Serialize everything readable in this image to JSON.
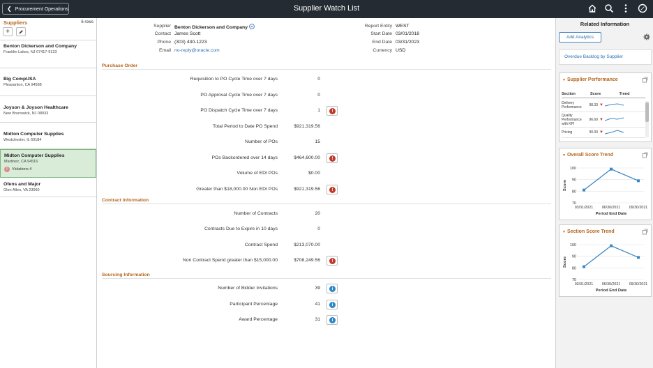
{
  "header": {
    "back_label": "Procurement Operations",
    "title": "Supplier Watch List"
  },
  "left": {
    "title": "Suppliers",
    "rows": "6 rows",
    "suppliers": [
      {
        "name": "Benton Dickerson and Company",
        "addr": "Franklin Lakes, NJ  07417-9123"
      },
      {
        "name": "Big CompUSA",
        "addr": "Pleasanton, CA  94588"
      },
      {
        "name": "Joyson & Joyson Healthcare",
        "addr": "New Brunswick, NJ  08933"
      },
      {
        "name": "Midton Computer Supplies",
        "addr": "Westchester, IL  60184"
      },
      {
        "name": "Midton Computer Supplies",
        "addr": "Martinez, CA  94516",
        "violations": "Violations 4"
      },
      {
        "name": "Ofens and Major",
        "addr": "Glen Allen, VA  23060"
      }
    ]
  },
  "info": {
    "supplier_label": "Supplier",
    "supplier": "Benton Dickerson and Company",
    "contact_label": "Contact",
    "contact": "James Scott",
    "phone_label": "Phone",
    "phone": "(303) 430-1223",
    "email_label": "Email",
    "email": "no-reply@oracle.com",
    "entity_label": "Report Entity",
    "entity": "WEST",
    "start_label": "Start Date",
    "start": "03/01/2018",
    "end_label": "End Date",
    "end": "03/31/2023",
    "currency_label": "Currency",
    "currency": "USD"
  },
  "sections": {
    "po": {
      "title": "Purchase Order",
      "rows": [
        {
          "label": "Requisition to PO Cycle Time over 7 days",
          "value": "0"
        },
        {
          "label": "PO Approval Cycle Time over 7 days",
          "value": "0"
        },
        {
          "label": "PO Dispatch Cycle Time over 7 days",
          "value": "1",
          "alert": "red"
        },
        {
          "label": "Total Period to Date PO Spend",
          "value": "$921,319.56"
        },
        {
          "label": "Number of POs",
          "value": "15"
        },
        {
          "label": "POs Backordered over 14 days",
          "value": "$464,600.00",
          "alert": "red"
        },
        {
          "label": "Volume of EDI POs",
          "value": "$0.00"
        },
        {
          "label": "Greater than $18,000.00 Non EDI POs",
          "value": "$921,319.56",
          "alert": "red"
        }
      ]
    },
    "contract": {
      "title": "Contract Information",
      "rows": [
        {
          "label": "Number of Contracts",
          "value": "20"
        },
        {
          "label": "Contracts Due to Expire in 10 days",
          "value": "0"
        },
        {
          "label": "Contract Spend",
          "value": "$213,070.00"
        },
        {
          "label": "Non Contract Spend greater than $15,000.00",
          "value": "$708,249.56",
          "alert": "red"
        }
      ]
    },
    "sourcing": {
      "title": "Sourcing Information",
      "rows": [
        {
          "label": "Number of Bidder Invitations",
          "value": "39",
          "alert": "blue"
        },
        {
          "label": "Participant Percentage",
          "value": "41",
          "alert": "blue"
        },
        {
          "label": "Award Percentage",
          "value": "31",
          "alert": "blue"
        }
      ]
    }
  },
  "right": {
    "title": "Related Information",
    "add_analytics": "Add Analytics",
    "overdue_link": "Overdue Backlog by Supplier",
    "supplier_perf": {
      "title": "Supplier Performance",
      "headers": [
        "Section",
        "Score",
        "Trend"
      ],
      "rows": [
        {
          "section": "Delivery Performance",
          "score": "98.33"
        },
        {
          "section": "Quality Performance with KPI",
          "score": "96.60"
        },
        {
          "section": "Pricing",
          "score": "90.00"
        }
      ]
    },
    "overall": {
      "title": "Overall Score Trend"
    },
    "section": {
      "title": "Section Score Trend"
    }
  },
  "chart_data": [
    {
      "type": "line",
      "title": "Overall Score Trend",
      "x": [
        "03/31/2021",
        "06/30/2021",
        "09/30/2021"
      ],
      "y": [
        81,
        99,
        89
      ],
      "yticks": [
        70,
        80,
        90,
        100
      ],
      "ylim": [
        70,
        100
      ],
      "xlabel": "Period End Date",
      "ylabel": "Score"
    },
    {
      "type": "line",
      "title": "Section Score Trend",
      "x": [
        "03/31/2021",
        "06/30/2021",
        "09/30/2021"
      ],
      "y": [
        81,
        99,
        89
      ],
      "yticks": [
        70,
        80,
        90,
        100
      ],
      "ylim": [
        70,
        100
      ],
      "xlabel": "Period End Date",
      "ylabel": "Score"
    }
  ]
}
